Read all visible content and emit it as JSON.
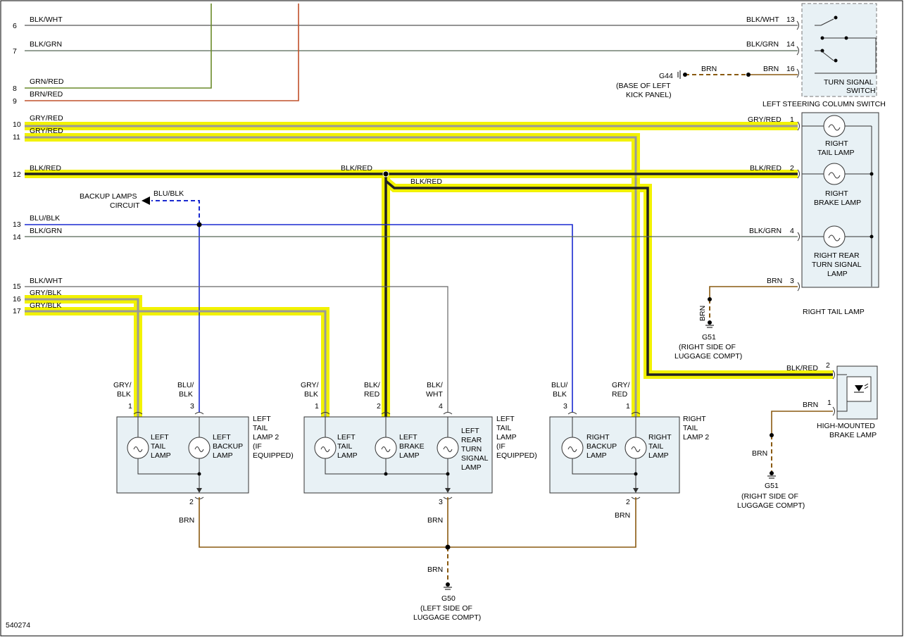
{
  "figure_id": "540274",
  "pins_left": [
    "6",
    "7",
    "8",
    "9",
    "10",
    "11",
    "12",
    "13",
    "14",
    "15",
    "16",
    "17"
  ],
  "wires": {
    "w6": "BLK/WHT",
    "w7": "BLK/GRN",
    "w8": "GRN/RED",
    "w9": "BRN/RED",
    "w10": "GRY/RED",
    "w11": "GRY/RED",
    "w12": "BLK/RED",
    "w12_mid": "BLK/RED",
    "w12_branch": "BLK/RED",
    "w13": "BLU/BLK",
    "w14": "BLK/GRN",
    "w15": "BLK/WHT",
    "w16": "GRY/BLK",
    "w17": "GRY/BLK",
    "backup_blu": "BLU/BLK"
  },
  "switch": {
    "label": "TURN SIGNAL SWITCH",
    "line1": "TURN SIGNAL",
    "line2": "SWITCH",
    "parent": "LEFT STEERING COLUMN SWITCH",
    "wire13": "BLK/WHT",
    "wire14": "BLK/GRN",
    "wire16": "BRN",
    "pin13": "13",
    "pin14": "14",
    "pin16": "16",
    "g44": "G44",
    "g44_brn": "BRN",
    "g44_loc1": "(BASE OF LEFT",
    "g44_loc2": "KICK PANEL)"
  },
  "right_tail": {
    "title": "RIGHT TAIL LAMP",
    "pin1_wire": "GRY/RED",
    "pin1": "1",
    "pin2_wire": "BLK/RED",
    "pin2": "2",
    "pin4_wire": "BLK/GRN",
    "pin4": "4",
    "pin3_wire": "BRN",
    "pin3": "3",
    "lamp1": [
      "RIGHT",
      "TAIL LAMP"
    ],
    "lamp2": [
      "RIGHT",
      "BRAKE LAMP"
    ],
    "lamp3": [
      "RIGHT REAR",
      "TURN SIGNAL",
      "LAMP"
    ],
    "ground_brn": "BRN",
    "ground": "G51",
    "ground_loc1": "(RIGHT SIDE OF",
    "ground_loc2": "LUGGAGE COMPT)"
  },
  "hmsl": {
    "title1": "HIGH-MOUNTED",
    "title2": "BRAKE LAMP",
    "pin2_wire": "BLK/RED",
    "pin2": "2",
    "pin1_wire": "BRN",
    "pin1": "1",
    "ground_brn": "BRN",
    "ground": "G51",
    "ground_loc1": "(RIGHT SIDE OF",
    "ground_loc2": "LUGGAGE COMPT)"
  },
  "backup": {
    "line1": "BACKUP LAMPS",
    "line2": "CIRCUIT"
  },
  "lt2": {
    "title": [
      "LEFT",
      "TAIL",
      "LAMP 2",
      "(IF",
      "EQUIPPED)"
    ],
    "pin1_wire": [
      "GRY/",
      "BLK"
    ],
    "pin1": "1",
    "pin3_wire": [
      "BLU/",
      "BLK"
    ],
    "pin3": "3",
    "pin2": "2",
    "pin2_wire": "BRN",
    "lamp1": [
      "LEFT",
      "TAIL",
      "LAMP"
    ],
    "lamp2": [
      "LEFT",
      "BACKUP",
      "LAMP"
    ]
  },
  "lt": {
    "title": [
      "LEFT",
      "TAIL",
      "LAMP",
      "(IF",
      "EQUIPPED)"
    ],
    "pin1_wire": [
      "GRY/",
      "BLK"
    ],
    "pin1": "1",
    "pin2_wire": [
      "BLK/",
      "RED"
    ],
    "pin2": "2",
    "pin4_wire": [
      "BLK/",
      "WHT"
    ],
    "pin4": "4",
    "pin3": "3",
    "pin3_wire": "BRN",
    "lamp1": [
      "LEFT",
      "TAIL",
      "LAMP"
    ],
    "lamp2": [
      "LEFT",
      "BRAKE",
      "LAMP"
    ],
    "lamp3": [
      "LEFT",
      "REAR",
      "TURN",
      "SIGNAL",
      "LAMP"
    ]
  },
  "rt2": {
    "title": [
      "RIGHT",
      "TAIL",
      "LAMP 2"
    ],
    "pin3_wire": [
      "BLU/",
      "BLK"
    ],
    "pin3": "3",
    "pin1_wire": [
      "GRY/",
      "RED"
    ],
    "pin1": "1",
    "pin2": "2",
    "pin2_wire": "BRN",
    "lamp1": [
      "RIGHT",
      "BACKUP",
      "LAMP"
    ],
    "lamp2": [
      "RIGHT",
      "TAIL",
      "LAMP"
    ]
  },
  "g50": {
    "brn": "BRN",
    "label": "G50",
    "loc1": "(LEFT SIDE OF",
    "loc2": "LUGGAGE COMPT)"
  },
  "colors": {
    "highlight": "#f2f200",
    "blk_wht": "#555555",
    "blk_grn": "#556655",
    "grn_red": "#6a8a2a",
    "brn_red": "#c0502a",
    "gry": "#9a9a9a",
    "blk": "#222222",
    "blu": "#1a2ad0",
    "brn": "#8a5a10",
    "panel": "#e8f1f5"
  }
}
